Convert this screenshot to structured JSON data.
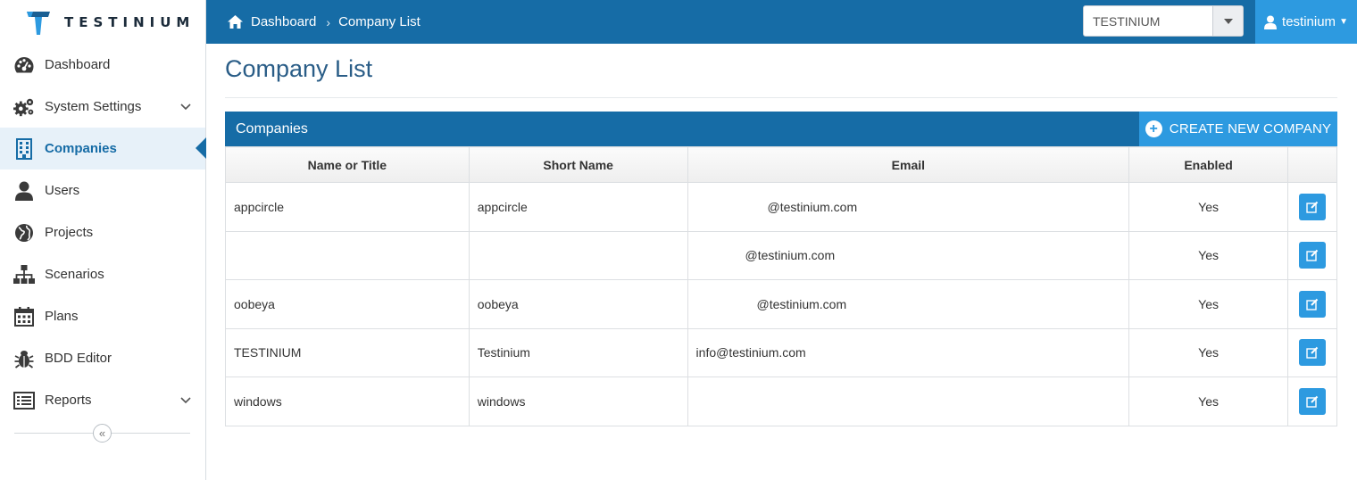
{
  "brand": {
    "name": "TESTINIUM"
  },
  "breadcrumb": {
    "home": "Dashboard",
    "current": "Company List"
  },
  "company_selector": {
    "value": "TESTINIUM"
  },
  "user_menu": {
    "username": "testinium"
  },
  "sidebar": {
    "items": [
      {
        "label": "Dashboard",
        "icon": "dashboard-icon"
      },
      {
        "label": "System Settings",
        "icon": "gears-icon",
        "expandable": true
      },
      {
        "label": "Companies",
        "icon": "building-icon",
        "active": true
      },
      {
        "label": "Users",
        "icon": "user-icon"
      },
      {
        "label": "Projects",
        "icon": "globe-icon"
      },
      {
        "label": "Scenarios",
        "icon": "sitemap-icon"
      },
      {
        "label": "Plans",
        "icon": "calendar-icon"
      },
      {
        "label": "BDD Editor",
        "icon": "bug-icon"
      },
      {
        "label": "Reports",
        "icon": "list-icon",
        "expandable": true
      }
    ],
    "collapse_glyph": "«"
  },
  "page": {
    "title": "Company List"
  },
  "panel": {
    "title": "Companies",
    "create_label": "CREATE NEW COMPANY"
  },
  "table": {
    "headers": [
      "Name or Title",
      "Short Name",
      "Email",
      "Enabled",
      ""
    ],
    "rows": [
      {
        "name": "appcircle",
        "short": "appcircle",
        "email": "@testinium.com",
        "enabled": "Yes"
      },
      {
        "name": "",
        "short": "",
        "email": "@testinium.com",
        "enabled": "Yes"
      },
      {
        "name": "oobeya",
        "short": "oobeya",
        "email": "@testinium.com",
        "enabled": "Yes"
      },
      {
        "name": "TESTINIUM",
        "short": "Testinium",
        "email": "info@testinium.com",
        "enabled": "Yes"
      },
      {
        "name": "windows",
        "short": "windows",
        "email": "",
        "enabled": "Yes"
      }
    ]
  },
  "colors": {
    "primary": "#166ca6",
    "accent": "#2d9ae0",
    "title": "#2a5d87"
  }
}
